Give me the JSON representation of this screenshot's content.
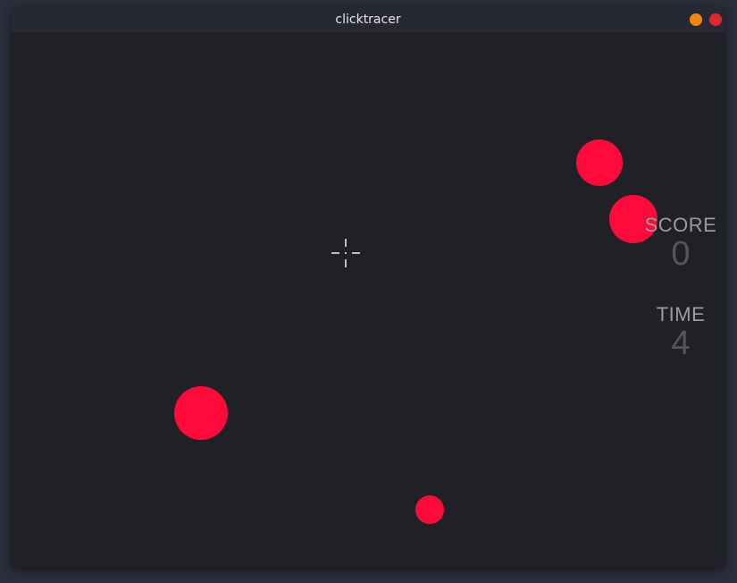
{
  "window": {
    "title": "clicktracer",
    "buttons": [
      {
        "name": "minimize",
        "color": "#f0860f"
      },
      {
        "name": "close",
        "color": "#e0262c"
      }
    ]
  },
  "game": {
    "background": "#202126",
    "target_color": "#ff0a3a",
    "target_count": 4,
    "cursor": "crosshair-icon"
  },
  "hud": {
    "score_label": "SCORE",
    "score_value": "0",
    "time_label": "TIME",
    "time_value": "4"
  }
}
